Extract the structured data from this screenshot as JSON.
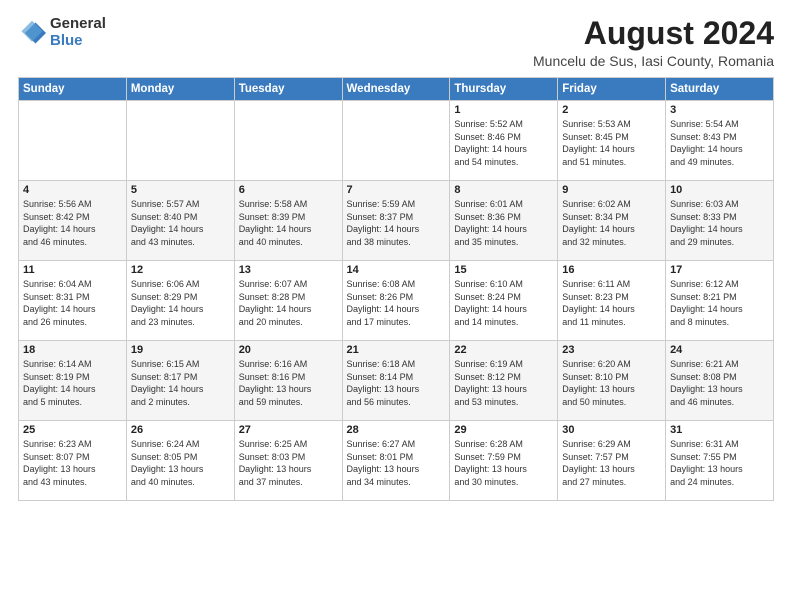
{
  "header": {
    "logo_general": "General",
    "logo_blue": "Blue",
    "title": "August 2024",
    "subtitle": "Muncelu de Sus, Iasi County, Romania"
  },
  "weekdays": [
    "Sunday",
    "Monday",
    "Tuesday",
    "Wednesday",
    "Thursday",
    "Friday",
    "Saturday"
  ],
  "weeks": [
    [
      {
        "day": "",
        "info": ""
      },
      {
        "day": "",
        "info": ""
      },
      {
        "day": "",
        "info": ""
      },
      {
        "day": "",
        "info": ""
      },
      {
        "day": "1",
        "info": "Sunrise: 5:52 AM\nSunset: 8:46 PM\nDaylight: 14 hours\nand 54 minutes."
      },
      {
        "day": "2",
        "info": "Sunrise: 5:53 AM\nSunset: 8:45 PM\nDaylight: 14 hours\nand 51 minutes."
      },
      {
        "day": "3",
        "info": "Sunrise: 5:54 AM\nSunset: 8:43 PM\nDaylight: 14 hours\nand 49 minutes."
      }
    ],
    [
      {
        "day": "4",
        "info": "Sunrise: 5:56 AM\nSunset: 8:42 PM\nDaylight: 14 hours\nand 46 minutes."
      },
      {
        "day": "5",
        "info": "Sunrise: 5:57 AM\nSunset: 8:40 PM\nDaylight: 14 hours\nand 43 minutes."
      },
      {
        "day": "6",
        "info": "Sunrise: 5:58 AM\nSunset: 8:39 PM\nDaylight: 14 hours\nand 40 minutes."
      },
      {
        "day": "7",
        "info": "Sunrise: 5:59 AM\nSunset: 8:37 PM\nDaylight: 14 hours\nand 38 minutes."
      },
      {
        "day": "8",
        "info": "Sunrise: 6:01 AM\nSunset: 8:36 PM\nDaylight: 14 hours\nand 35 minutes."
      },
      {
        "day": "9",
        "info": "Sunrise: 6:02 AM\nSunset: 8:34 PM\nDaylight: 14 hours\nand 32 minutes."
      },
      {
        "day": "10",
        "info": "Sunrise: 6:03 AM\nSunset: 8:33 PM\nDaylight: 14 hours\nand 29 minutes."
      }
    ],
    [
      {
        "day": "11",
        "info": "Sunrise: 6:04 AM\nSunset: 8:31 PM\nDaylight: 14 hours\nand 26 minutes."
      },
      {
        "day": "12",
        "info": "Sunrise: 6:06 AM\nSunset: 8:29 PM\nDaylight: 14 hours\nand 23 minutes."
      },
      {
        "day": "13",
        "info": "Sunrise: 6:07 AM\nSunset: 8:28 PM\nDaylight: 14 hours\nand 20 minutes."
      },
      {
        "day": "14",
        "info": "Sunrise: 6:08 AM\nSunset: 8:26 PM\nDaylight: 14 hours\nand 17 minutes."
      },
      {
        "day": "15",
        "info": "Sunrise: 6:10 AM\nSunset: 8:24 PM\nDaylight: 14 hours\nand 14 minutes."
      },
      {
        "day": "16",
        "info": "Sunrise: 6:11 AM\nSunset: 8:23 PM\nDaylight: 14 hours\nand 11 minutes."
      },
      {
        "day": "17",
        "info": "Sunrise: 6:12 AM\nSunset: 8:21 PM\nDaylight: 14 hours\nand 8 minutes."
      }
    ],
    [
      {
        "day": "18",
        "info": "Sunrise: 6:14 AM\nSunset: 8:19 PM\nDaylight: 14 hours\nand 5 minutes."
      },
      {
        "day": "19",
        "info": "Sunrise: 6:15 AM\nSunset: 8:17 PM\nDaylight: 14 hours\nand 2 minutes."
      },
      {
        "day": "20",
        "info": "Sunrise: 6:16 AM\nSunset: 8:16 PM\nDaylight: 13 hours\nand 59 minutes."
      },
      {
        "day": "21",
        "info": "Sunrise: 6:18 AM\nSunset: 8:14 PM\nDaylight: 13 hours\nand 56 minutes."
      },
      {
        "day": "22",
        "info": "Sunrise: 6:19 AM\nSunset: 8:12 PM\nDaylight: 13 hours\nand 53 minutes."
      },
      {
        "day": "23",
        "info": "Sunrise: 6:20 AM\nSunset: 8:10 PM\nDaylight: 13 hours\nand 50 minutes."
      },
      {
        "day": "24",
        "info": "Sunrise: 6:21 AM\nSunset: 8:08 PM\nDaylight: 13 hours\nand 46 minutes."
      }
    ],
    [
      {
        "day": "25",
        "info": "Sunrise: 6:23 AM\nSunset: 8:07 PM\nDaylight: 13 hours\nand 43 minutes."
      },
      {
        "day": "26",
        "info": "Sunrise: 6:24 AM\nSunset: 8:05 PM\nDaylight: 13 hours\nand 40 minutes."
      },
      {
        "day": "27",
        "info": "Sunrise: 6:25 AM\nSunset: 8:03 PM\nDaylight: 13 hours\nand 37 minutes."
      },
      {
        "day": "28",
        "info": "Sunrise: 6:27 AM\nSunset: 8:01 PM\nDaylight: 13 hours\nand 34 minutes."
      },
      {
        "day": "29",
        "info": "Sunrise: 6:28 AM\nSunset: 7:59 PM\nDaylight: 13 hours\nand 30 minutes."
      },
      {
        "day": "30",
        "info": "Sunrise: 6:29 AM\nSunset: 7:57 PM\nDaylight: 13 hours\nand 27 minutes."
      },
      {
        "day": "31",
        "info": "Sunrise: 6:31 AM\nSunset: 7:55 PM\nDaylight: 13 hours\nand 24 minutes."
      }
    ]
  ]
}
